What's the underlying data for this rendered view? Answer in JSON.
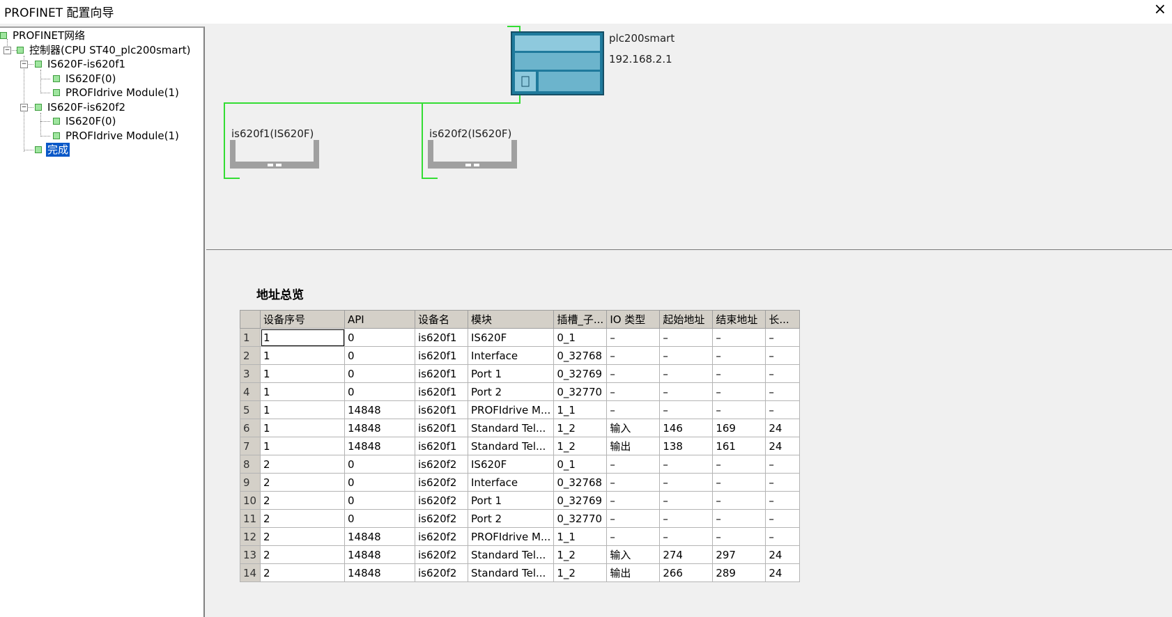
{
  "window": {
    "title": "PROFINET 配置向导",
    "close_label": "×"
  },
  "tree": {
    "items": [
      {
        "label": "PROFINET网络"
      },
      {
        "label": "控制器(CPU ST40_plc200smart)"
      },
      {
        "label": "IS620F-is620f1"
      },
      {
        "label": "IS620F(0)"
      },
      {
        "label": "PROFIdrive Module(1)"
      },
      {
        "label": "IS620F-is620f2"
      },
      {
        "label": "IS620F(0)"
      },
      {
        "label": "PROFIdrive Module(1)"
      },
      {
        "label": "完成"
      }
    ],
    "expander_symbol": "−"
  },
  "network": {
    "controller": {
      "name": "plc200smart",
      "ip": "192.168.2.1"
    },
    "devices": [
      {
        "label": "is620f1(IS620F)"
      },
      {
        "label": "is620f2(IS620F)"
      }
    ],
    "link_color": "#33dd33",
    "plc_color": "#1f7a9c"
  },
  "address_overview": {
    "title": "地址总览",
    "columns": [
      "设备序号",
      "API",
      "设备名",
      "模块",
      "插槽_子...",
      "IO 类型",
      "起始地址",
      "结束地址",
      "长..."
    ],
    "rows": [
      [
        "1",
        "1",
        "0",
        "is620f1",
        "IS620F",
        "0_1",
        "–",
        "–",
        "–",
        "–"
      ],
      [
        "2",
        "1",
        "0",
        "is620f1",
        "Interface",
        "0_32768",
        "–",
        "–",
        "–",
        "–"
      ],
      [
        "3",
        "1",
        "0",
        "is620f1",
        "Port 1",
        "0_32769",
        "–",
        "–",
        "–",
        "–"
      ],
      [
        "4",
        "1",
        "0",
        "is620f1",
        "Port 2",
        "0_32770",
        "–",
        "–",
        "–",
        "–"
      ],
      [
        "5",
        "1",
        "14848",
        "is620f1",
        "PROFIdrive M...",
        "1_1",
        "–",
        "–",
        "–",
        "–"
      ],
      [
        "6",
        "1",
        "14848",
        "is620f1",
        "Standard Tel...",
        "1_2",
        "输入",
        "146",
        "169",
        "24"
      ],
      [
        "7",
        "1",
        "14848",
        "is620f1",
        "Standard Tel...",
        "1_2",
        "输出",
        "138",
        "161",
        "24"
      ],
      [
        "8",
        "2",
        "0",
        "is620f2",
        "IS620F",
        "0_1",
        "–",
        "–",
        "–",
        "–"
      ],
      [
        "9",
        "2",
        "0",
        "is620f2",
        "Interface",
        "0_32768",
        "–",
        "–",
        "–",
        "–"
      ],
      [
        "10",
        "2",
        "0",
        "is620f2",
        "Port 1",
        "0_32769",
        "–",
        "–",
        "–",
        "–"
      ],
      [
        "11",
        "2",
        "0",
        "is620f2",
        "Port 2",
        "0_32770",
        "–",
        "–",
        "–",
        "–"
      ],
      [
        "12",
        "2",
        "14848",
        "is620f2",
        "PROFIdrive M...",
        "1_1",
        "–",
        "–",
        "–",
        "–"
      ],
      [
        "13",
        "2",
        "14848",
        "is620f2",
        "Standard Tel...",
        "1_2",
        "输入",
        "274",
        "297",
        "24"
      ],
      [
        "14",
        "2",
        "14848",
        "is620f2",
        "Standard Tel...",
        "1_2",
        "输出",
        "266",
        "289",
        "24"
      ]
    ]
  }
}
